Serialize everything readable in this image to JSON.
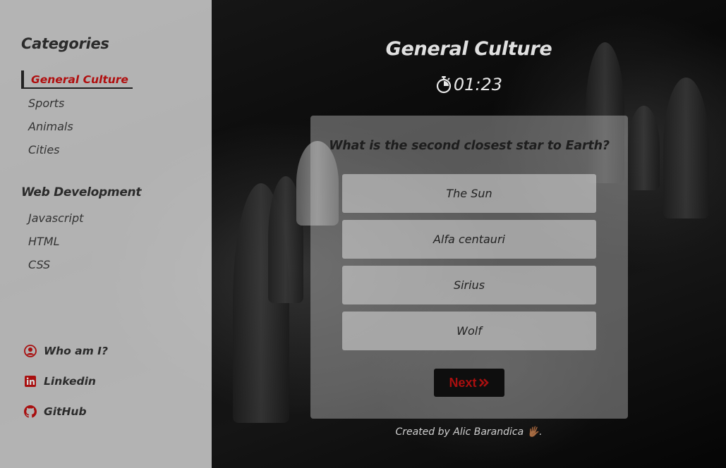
{
  "sidebar": {
    "heading": "Categories",
    "categories": [
      {
        "label": "General Culture",
        "active": true
      },
      {
        "label": "Sports"
      },
      {
        "label": "Animals"
      },
      {
        "label": "Cities"
      }
    ],
    "web_heading": "Web Development",
    "web_categories": [
      {
        "label": "Javascript"
      },
      {
        "label": "HTML"
      },
      {
        "label": "CSS"
      }
    ],
    "links": [
      {
        "label": "Who am I?",
        "icon": "user-circle-icon"
      },
      {
        "label": "Linkedin",
        "icon": "linkedin-icon"
      },
      {
        "label": "GitHub",
        "icon": "github-icon"
      }
    ]
  },
  "quiz": {
    "title": "General Culture",
    "timer": "01:23",
    "question": "What is the second closest star to Earth?",
    "answers": [
      "The Sun",
      "Alfa centauri",
      "Sirius",
      "Wolf"
    ],
    "next_label": "Next",
    "next_icon": "double-chevron-right-icon"
  },
  "footer": {
    "text": "Created by Alic Barandica",
    "emoji": "🖐🏾",
    "trail": "."
  },
  "colors": {
    "accent": "#b00e0e",
    "sidebar_bg": "#d7d7d7",
    "card_bg": "#8a8a8a"
  }
}
